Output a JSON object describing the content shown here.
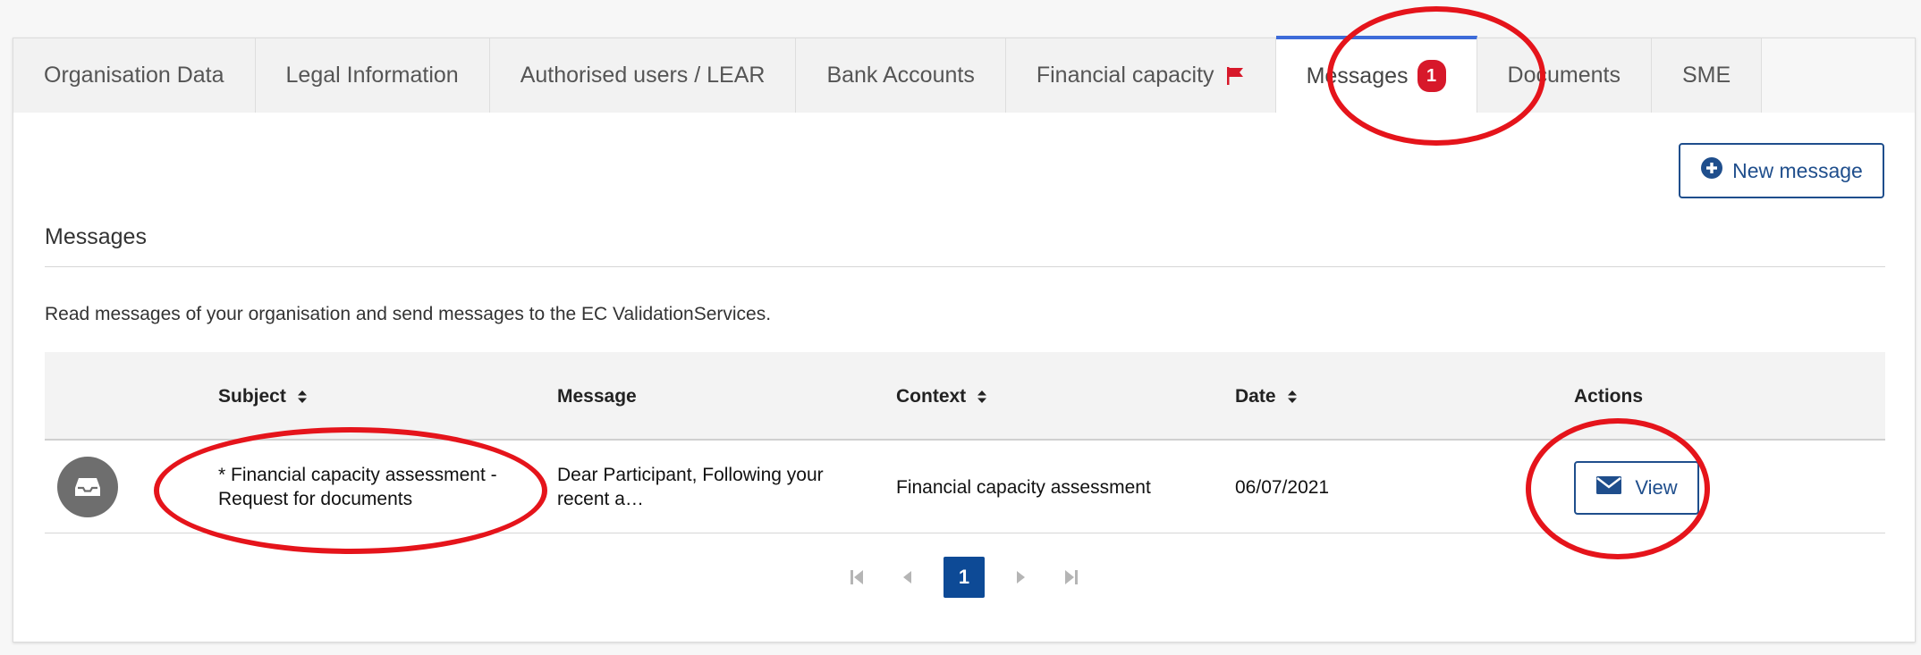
{
  "tabs": [
    {
      "label": "Organisation Data"
    },
    {
      "label": "Legal Information"
    },
    {
      "label": "Authorised users / LEAR"
    },
    {
      "label": "Bank Accounts"
    },
    {
      "label": "Financial capacity",
      "flag": "red-flag-icon"
    },
    {
      "label": "Messages",
      "badge": "1",
      "active": true
    },
    {
      "label": "Documents"
    },
    {
      "label": "SME"
    }
  ],
  "actions": {
    "new_message_label": "New message",
    "new_message_icon": "plus-circle-icon"
  },
  "section": {
    "title": "Messages",
    "description": "Read messages of your organisation and send messages to the EC ValidationServices."
  },
  "table": {
    "columns": [
      {
        "label": "Subject",
        "sortable": true
      },
      {
        "label": "Message",
        "sortable": false
      },
      {
        "label": "Context",
        "sortable": true
      },
      {
        "label": "Date",
        "sortable": true
      },
      {
        "label": "Actions",
        "sortable": false
      }
    ],
    "rows": [
      {
        "icon": "inbox-icon",
        "subject": "* Financial capacity assessment - Request for documents",
        "message": "Dear Participant, Following your recent a…",
        "context": "Financial capacity assessment",
        "date": "06/07/2021",
        "action_label": "View",
        "action_icon": "envelope-icon"
      }
    ]
  },
  "pagination": {
    "current_page": "1"
  },
  "colors": {
    "accent": "#1f4e8c",
    "active_tab_border": "#3d6bd9",
    "badge": "#d7182a",
    "annotation": "#e5141b",
    "page_active": "#0d4a96"
  }
}
